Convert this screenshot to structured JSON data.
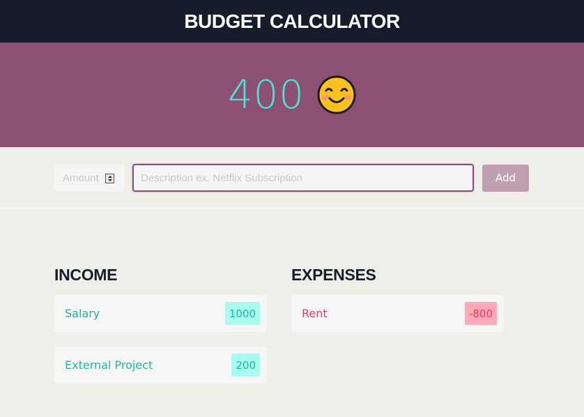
{
  "header": {
    "title": "BUDGET CALCULATOR"
  },
  "balance": {
    "value": "400",
    "mood_icon": "smiling-face-icon"
  },
  "form": {
    "amount_placeholder": "Amount",
    "amount_value": "",
    "description_placeholder": "Description ex. Netflix Subscription",
    "description_value": "",
    "add_label": "Add"
  },
  "income": {
    "heading": "INCOME",
    "items": [
      {
        "label": "Salary",
        "value": "1000"
      },
      {
        "label": "External Project",
        "value": "200"
      }
    ]
  },
  "expenses": {
    "heading": "EXPENSES",
    "items": [
      {
        "label": "Rent",
        "value": "-800"
      }
    ]
  },
  "colors": {
    "header_bg": "#161c29",
    "hero_bg": "#8c5072",
    "balance_text": "#45e6da",
    "income_text": "#1fb79a",
    "income_badge": "#a8fbef",
    "expense_text": "#f03b5e",
    "expense_badge": "#ffa9b8",
    "add_button": "#bf9fb0"
  }
}
